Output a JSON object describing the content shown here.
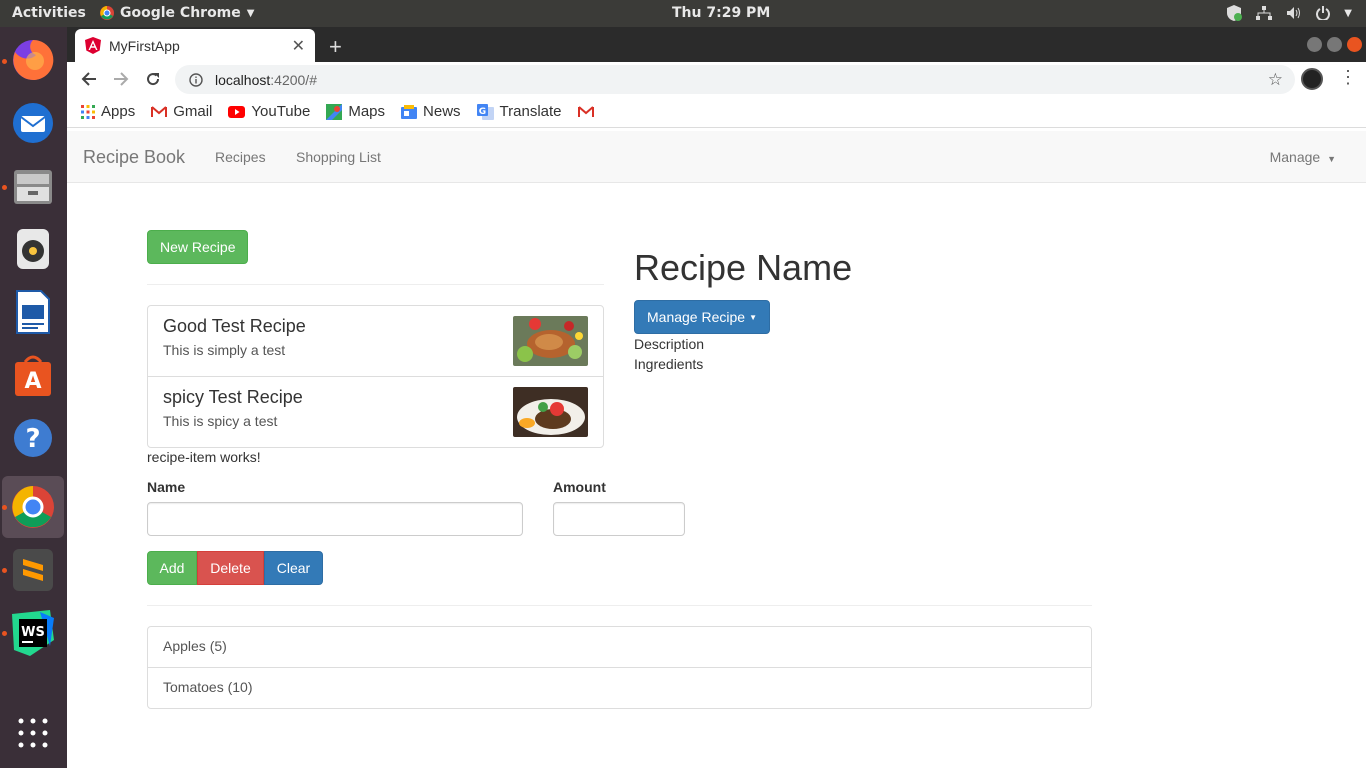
{
  "system": {
    "activities": "Activities",
    "app_name": "Google Chrome",
    "clock": "Thu  7:29 PM"
  },
  "browser": {
    "tab_title": "MyFirstApp",
    "url_host": "localhost",
    "url_path": ":4200/#",
    "bookmarks": [
      "Apps",
      "Gmail",
      "YouTube",
      "Maps",
      "News",
      "Translate"
    ]
  },
  "navbar": {
    "brand": "Recipe Book",
    "links": [
      "Recipes",
      "Shopping List"
    ],
    "manage": "Manage"
  },
  "recipes": {
    "new_button": "New Recipe",
    "items": [
      {
        "name": "Good Test Recipe",
        "description": "This is simply a test"
      },
      {
        "name": "spicy Test Recipe",
        "description": "This is spicy a test"
      }
    ],
    "item_works": "recipe-item works!"
  },
  "detail": {
    "title": "Recipe Name",
    "manage_button": "Manage Recipe",
    "description_label": "Description",
    "ingredients_label": "Ingredients"
  },
  "shopping_form": {
    "name_label": "Name",
    "amount_label": "Amount",
    "name_value": "",
    "amount_value": "",
    "add": "Add",
    "delete": "Delete",
    "clear": "Clear"
  },
  "shopping_list": [
    "Apples (5)",
    "Tomatoes (10)"
  ],
  "colors": {
    "success": "#5cb85c",
    "danger": "#d9534f",
    "primary": "#337ab7",
    "ubuntu_orange": "#e95420"
  }
}
